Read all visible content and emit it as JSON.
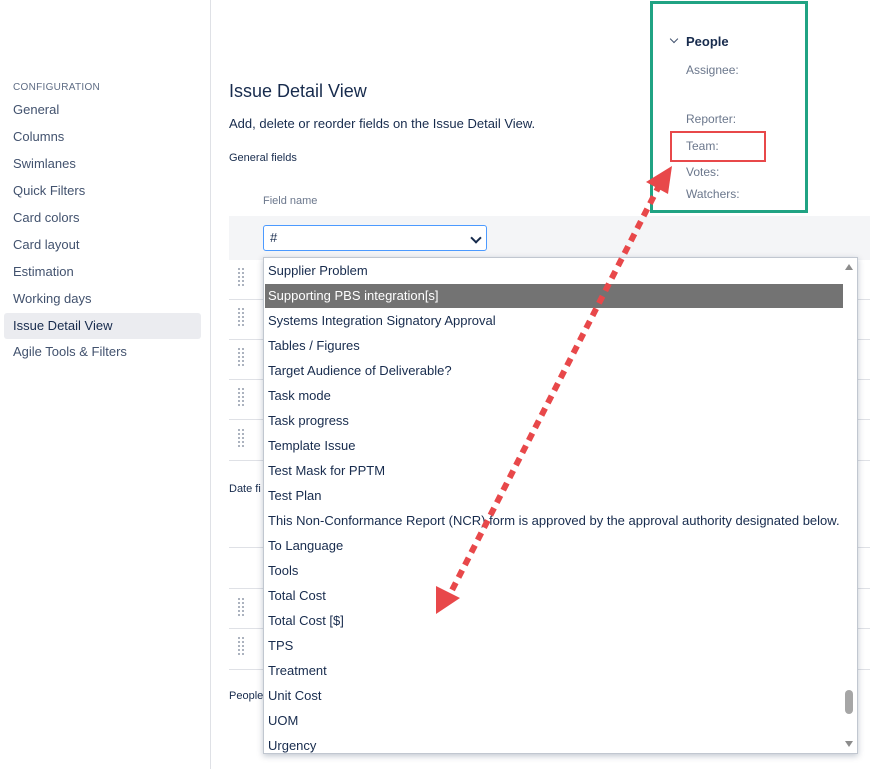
{
  "sidebar": {
    "heading": "CONFIGURATION",
    "items": [
      {
        "label": "General"
      },
      {
        "label": "Columns"
      },
      {
        "label": "Swimlanes"
      },
      {
        "label": "Quick Filters"
      },
      {
        "label": "Card colors"
      },
      {
        "label": "Card layout"
      },
      {
        "label": "Estimation"
      },
      {
        "label": "Working days"
      },
      {
        "label": "Issue Detail View",
        "active": true
      },
      {
        "label": "Agile Tools & Filters"
      }
    ]
  },
  "main": {
    "title": "Issue Detail View",
    "description": "Add, delete or reorder fields on the Issue Detail View.",
    "general_fields_label": "General fields",
    "field_name_header": "Field name",
    "select_value": "#",
    "date_fields_label": "Date fi",
    "people_label": "People"
  },
  "dropdown": {
    "highlighted_index": 1,
    "options": [
      "Supplier Problem",
      "Supporting PBS integration[s]",
      "Systems Integration Signatory Approval",
      "Tables / Figures",
      "Target Audience of Deliverable?",
      "Task mode",
      "Task progress",
      "Template Issue",
      "Test Mask for PPTM",
      "Test Plan",
      "This Non-Conformance Report (NCR) form is approved by the approval authority designated below.",
      "To Language",
      "Tools",
      "Total Cost",
      "Total Cost [$]",
      "TPS",
      "Treatment",
      "Unit Cost",
      "UOM",
      "Urgency"
    ]
  },
  "people_panel": {
    "title": "People",
    "fields": [
      "Assignee:",
      "Reporter:",
      "Team:",
      "Votes:",
      "Watchers:"
    ]
  },
  "colors": {
    "panel_border": "#20a383",
    "highlight_box": "#e8484a",
    "arrow": "#e8484a",
    "option_highlight": "#737373",
    "select_border": "#4c9aff"
  },
  "icons": [
    "chevron-down-icon",
    "drag-handle-icon",
    "scroll-up-arrow-icon",
    "scroll-down-arrow-icon",
    "double-headed-arrow"
  ]
}
